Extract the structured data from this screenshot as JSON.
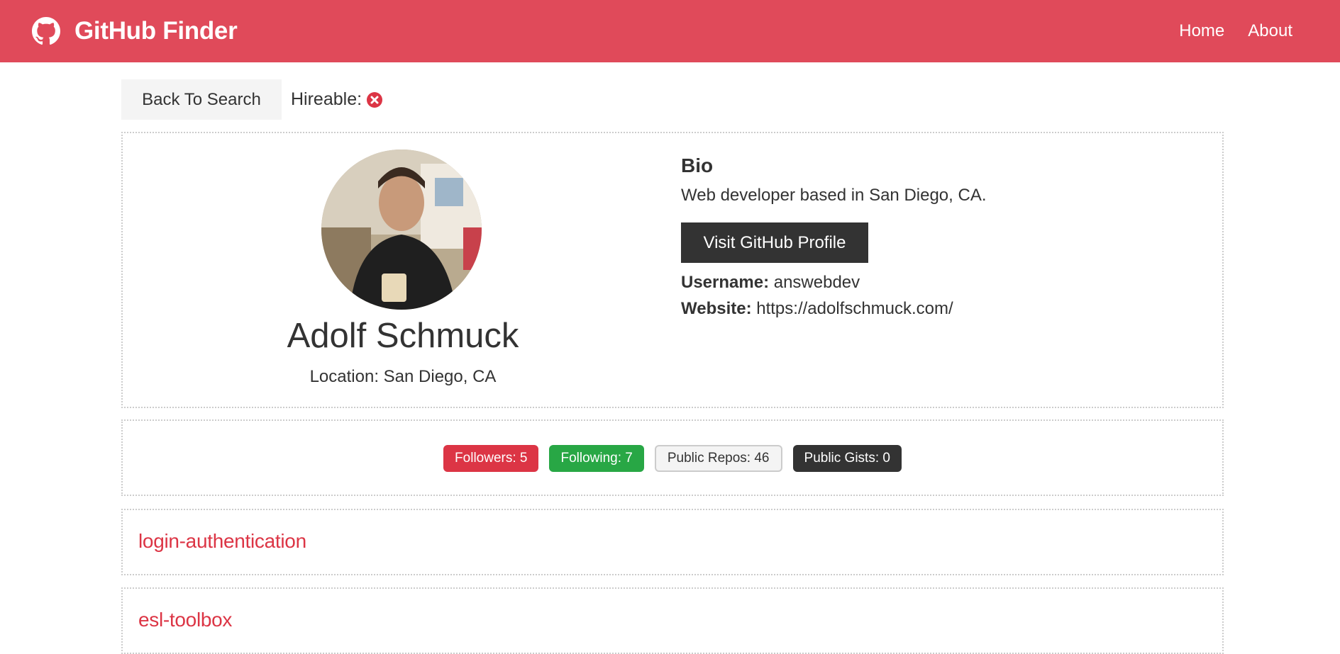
{
  "navbar": {
    "title": "GitHub Finder",
    "links": [
      "Home",
      "About"
    ],
    "brand_icon": "github-icon",
    "color": "#e04a5a"
  },
  "topbar": {
    "back_label": "Back To Search",
    "hireable_label": "Hireable:",
    "hireable_icon": "times-circle-icon"
  },
  "profile": {
    "name": "Adolf Schmuck",
    "location": "Location: San Diego, CA",
    "bio_title": "Bio",
    "bio_text": "Web developer based in San Diego, CA.",
    "visit_label": "Visit GitHub Profile",
    "username_label": "Username:",
    "username": "answebdev",
    "website_label": "Website:",
    "website": "https://adolfschmuck.com/"
  },
  "stats": {
    "followers": "Followers: 5",
    "following": "Following: 7",
    "public_repos": "Public Repos: 46",
    "public_gists": "Public Gists: 0"
  },
  "repos": [
    "login-authentication",
    "esl-toolbox"
  ],
  "colors": {
    "primary": "#dc3545",
    "success": "#28a745",
    "dark": "#333333",
    "light": "#f4f4f4"
  }
}
